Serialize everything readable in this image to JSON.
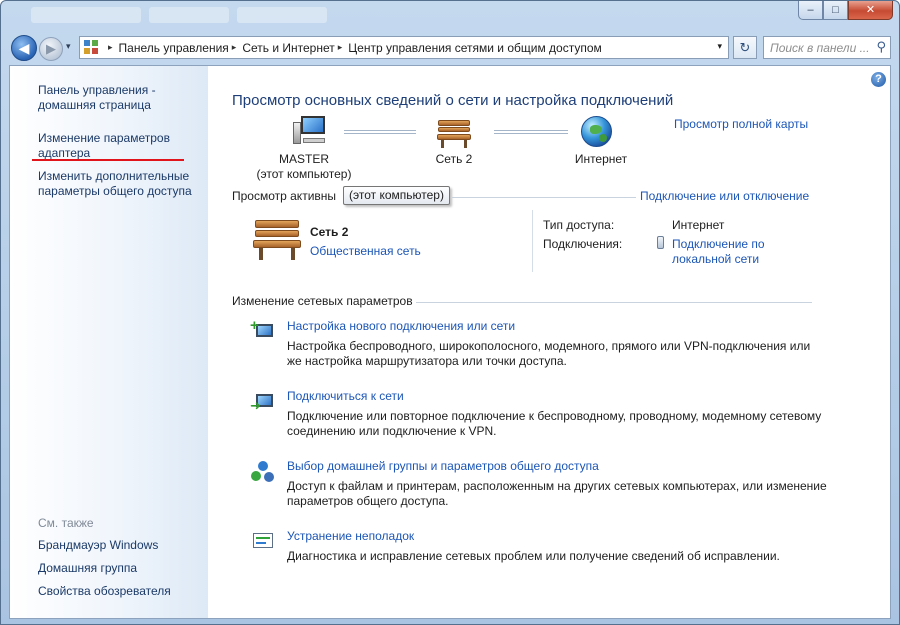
{
  "window": {
    "minimize_label": "–",
    "maximize_label": "□",
    "close_label": "✕"
  },
  "navigation": {
    "back_label": "◀",
    "forward_label": "▶",
    "dropdown_label": "▾",
    "refresh_label": "↻"
  },
  "address_bar": {
    "crumbs": [
      "Панель управления",
      "Сеть и Интернет",
      "Центр управления сетями и общим доступом"
    ],
    "separator": "▸"
  },
  "search": {
    "placeholder": "Поиск в панели ...",
    "icon": "search-icon"
  },
  "sidebar": {
    "home_link": [
      "Панель управления -",
      "домашняя страница"
    ],
    "adapter_link": [
      "Изменение параметров",
      "адаптера"
    ],
    "sharing_link": [
      "Изменить дополнительные",
      "параметры общего доступа"
    ],
    "see_also_label": "См. также",
    "see_also_links": [
      "Брандмауэр Windows",
      "Домашняя группа",
      "Свойства обозревателя"
    ],
    "highlight_color": "#e2141b"
  },
  "main": {
    "help_label": "?",
    "title": "Просмотр основных сведений о сети и настройка подключений",
    "map_link": "Просмотр полной карты",
    "nodes": {
      "computer_name": "MASTER",
      "computer_caption": "(этот компьютер)",
      "network_name": "Сеть 2",
      "internet_name": "Интернет"
    },
    "active_networks_label": "Просмотр активны",
    "tooltip": "(этот компьютер)",
    "connect_link": "Подключение или отключение",
    "active_network": {
      "name": "Сеть 2",
      "type": "Общественная сеть",
      "access_label": "Тип доступа:",
      "access_value": "Интернет",
      "connections_label": "Подключения:",
      "connections_value": [
        "Подключение по",
        "локальной сети"
      ]
    },
    "settings_section_label": "Изменение сетевых параметров",
    "tasks": [
      {
        "icon": "new-connection-icon",
        "link": "Настройка нового подключения или сети",
        "description": "Настройка беспроводного, широкополосного, модемного, прямого или VPN-подключения или же настройка маршрутизатора или точки доступа."
      },
      {
        "icon": "connect-network-icon",
        "link": "Подключиться к сети",
        "description": "Подключение или повторное подключение к беспроводному, проводному, модемному сетевому соединению или подключение к VPN."
      },
      {
        "icon": "homegroup-icon",
        "link": "Выбор домашней группы и параметров общего доступа",
        "description": "Доступ к файлам и принтерам, расположенным на других сетевых компьютерах, или изменение параметров общего доступа."
      },
      {
        "icon": "troubleshoot-icon",
        "link": "Устранение неполадок",
        "description": "Диагностика и исправление сетевых проблем или получение сведений об исправлении."
      }
    ],
    "link_color": "#1c56b6",
    "title_color": "#1e3f78"
  }
}
